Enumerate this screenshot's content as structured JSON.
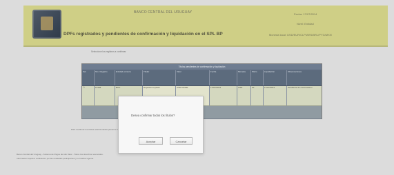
{
  "header": {
    "bank_name": "BANCO CENTRAL DEL URUGUAY",
    "title": "DPFs registrados y pendientes de confirmación y liquidación en el SPL BP",
    "meta_1": "Fecha: 17/07/2014",
    "meta_2": "Nivel: Entidad",
    "meta_3": "Moneda local: USD/EUR/CLP/ARS/BRL/PYG/MXN"
  },
  "body": {
    "top_text": "Seleccione los registros a confirmar",
    "table_title": "Títulos pendientes de confirmación y liquidación",
    "columns": [
      "Sel.",
      "Nro. Registro",
      "Entidad emisora",
      "Titular",
      "Valor",
      "Fecha",
      "Moneda",
      "Plazo",
      "Liquidación",
      "Observaciones"
    ],
    "row": [
      "☐",
      "12345",
      "BCU",
      "Depósitos a plazo",
      "USD 50.000",
      "17/07/2014",
      "USD",
      "30",
      "17/07/2014",
      "Pendiente de confirmación"
    ],
    "bottom_note": "Para confirmar los títulos seleccionados presione Confirmar.",
    "footer_lines": [
      "Banco Central del Uruguay - Sistema de Pagos de Alto Valor - Todos los derechos reservados.",
      "Información sujeta a verificación por las entidades participantes y normativa vigente."
    ]
  },
  "dialog": {
    "message": "Desea confirmar todos los títulos?",
    "accept_label": "Aceptar",
    "cancel_label": "Cancelar"
  }
}
